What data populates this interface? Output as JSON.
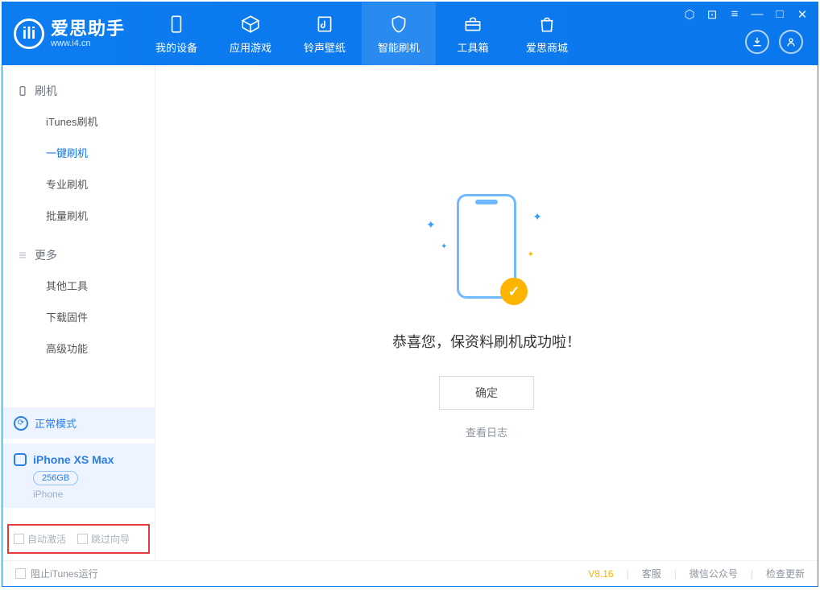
{
  "app": {
    "title": "爱思助手",
    "subtitle": "www.i4.cn"
  },
  "nav": {
    "items": [
      {
        "label": "我的设备"
      },
      {
        "label": "应用游戏"
      },
      {
        "label": "铃声壁纸"
      },
      {
        "label": "智能刷机"
      },
      {
        "label": "工具箱"
      },
      {
        "label": "爱思商城"
      }
    ]
  },
  "sidebar": {
    "section1_title": "刷机",
    "section1_items": [
      "iTunes刷机",
      "一键刷机",
      "专业刷机",
      "批量刷机"
    ],
    "section2_title": "更多",
    "section2_items": [
      "其他工具",
      "下载固件",
      "高级功能"
    ],
    "mode_label": "正常模式",
    "device_name": "iPhone XS Max",
    "device_storage": "256GB",
    "device_type": "iPhone",
    "checkbox1_label": "自动激活",
    "checkbox2_label": "跳过向导"
  },
  "main": {
    "success_text": "恭喜您，保资料刷机成功啦！",
    "ok_button": "确定",
    "view_log": "查看日志"
  },
  "footer": {
    "block_itunes": "阻止iTunes运行",
    "version": "V8.16",
    "support": "客服",
    "wechat": "微信公众号",
    "check_update": "检查更新"
  }
}
